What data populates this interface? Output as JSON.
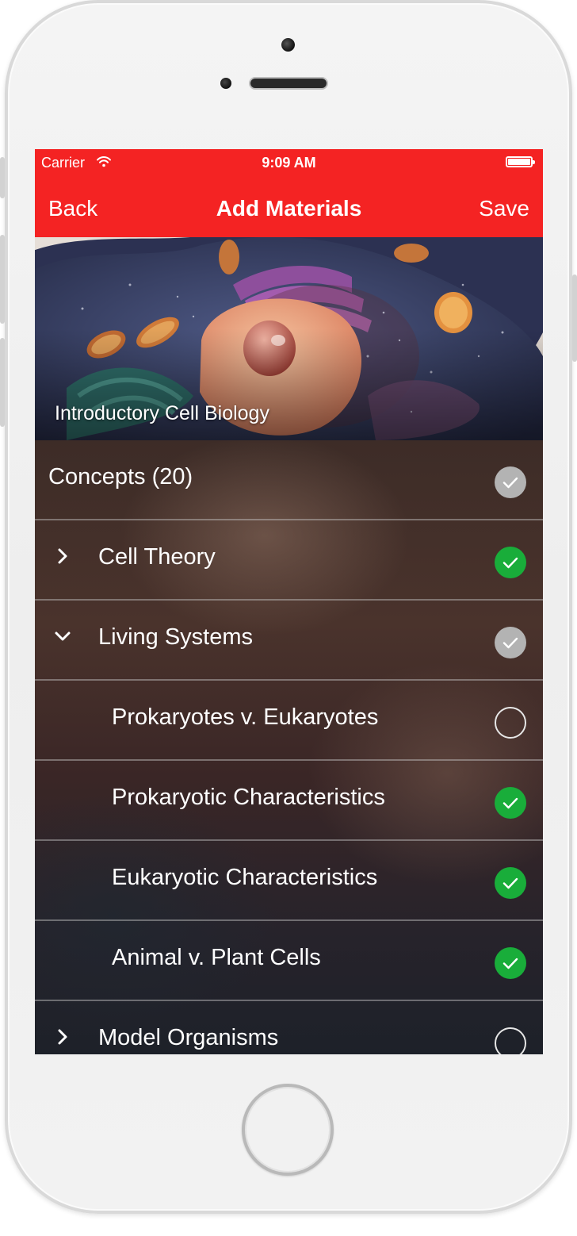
{
  "status_bar": {
    "carrier": "Carrier",
    "time": "9:09 AM"
  },
  "nav": {
    "back_label": "Back",
    "title": "Add Materials",
    "save_label": "Save"
  },
  "hero": {
    "title": "Introductory Cell Biology"
  },
  "list": {
    "header": {
      "label": "Concepts (20)",
      "check_state": "partial"
    },
    "rows": [
      {
        "label": "Cell Theory",
        "chevron": "collapsed",
        "check_state": "checked"
      },
      {
        "label": "Living Systems",
        "chevron": "expanded",
        "check_state": "partial"
      },
      {
        "label": "Prokaryotes v. Eukaryotes",
        "chevron": "none",
        "check_state": "unchecked"
      },
      {
        "label": "Prokaryotic Characteristics",
        "chevron": "none",
        "check_state": "checked"
      },
      {
        "label": "Eukaryotic Characteristics",
        "chevron": "none",
        "check_state": "checked"
      },
      {
        "label": "Animal v. Plant Cells",
        "chevron": "none",
        "check_state": "checked"
      },
      {
        "label": "Model Organisms",
        "chevron": "collapsed",
        "check_state": "unchecked"
      }
    ]
  },
  "colors": {
    "accent": "#f42323",
    "checked": "#19ad3a",
    "partial": "#b3b3b3"
  },
  "icons": {
    "wifi": "wifi-icon",
    "battery": "battery-icon",
    "collapsed": "chevron-right-icon",
    "expanded": "chevron-down-icon",
    "checked": "checkmark-circle-icon"
  }
}
